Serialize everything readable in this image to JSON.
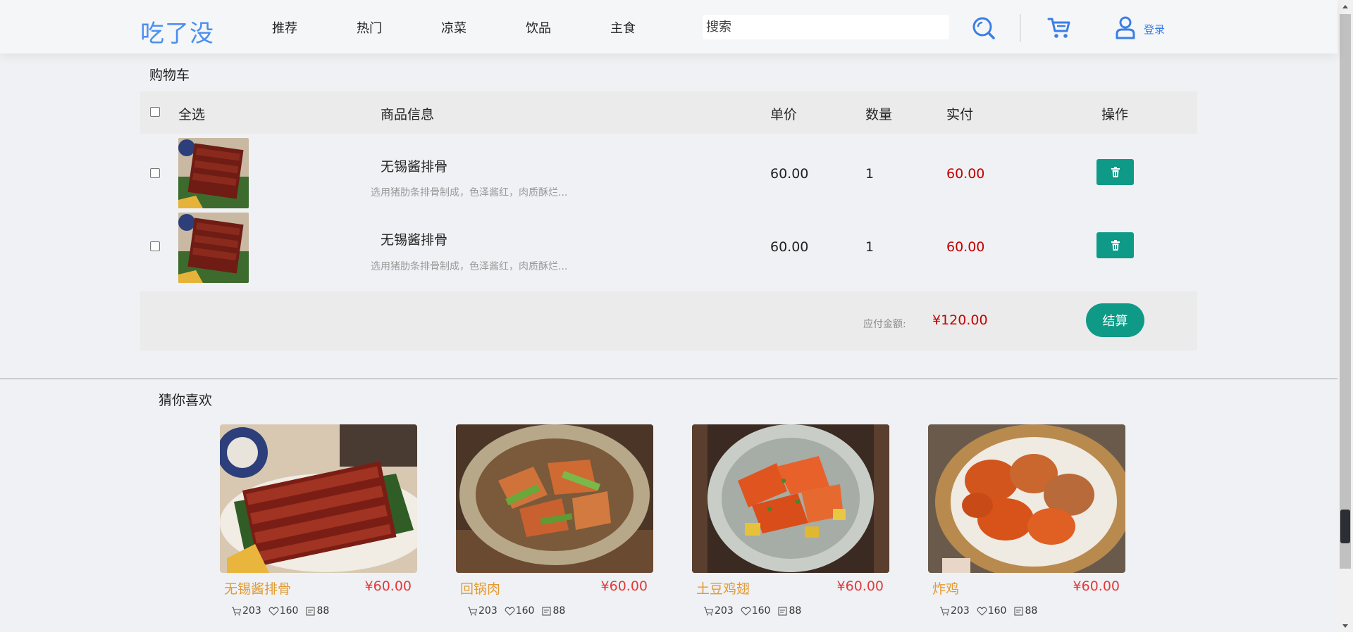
{
  "header": {
    "logo": "吃了没",
    "nav": [
      "推荐",
      "热门",
      "凉菜",
      "饮品",
      "主食"
    ],
    "search_placeholder": "搜索",
    "login_label": "登录"
  },
  "cart": {
    "title": "购物车",
    "columns": {
      "select_all": "全选",
      "product_info": "商品信息",
      "unit_price": "单价",
      "quantity": "数量",
      "paid": "实付",
      "actions": "操作"
    },
    "items": [
      {
        "name": "无锡酱排骨",
        "desc": "选用猪肋条排骨制成，色泽酱红，肉质酥烂...",
        "unit_price": "60.00",
        "quantity": "1",
        "paid": "60.00"
      },
      {
        "name": "无锡酱排骨",
        "desc": "选用猪肋条排骨制成，色泽酱红，肉质酥烂...",
        "unit_price": "60.00",
        "quantity": "1",
        "paid": "60.00"
      }
    ],
    "total_label": "应付金额:",
    "total_value": "¥120.00",
    "checkout_label": "结算"
  },
  "recommend": {
    "title": "猜你喜欢",
    "items": [
      {
        "name": "无锡酱排骨",
        "price": "¥60.00",
        "cart_count": "203",
        "like_count": "160",
        "comment_count": "88"
      },
      {
        "name": "回锅肉",
        "price": "¥60.00",
        "cart_count": "203",
        "like_count": "160",
        "comment_count": "88"
      },
      {
        "name": "土豆鸡翅",
        "price": "¥60.00",
        "cart_count": "203",
        "like_count": "160",
        "comment_count": "88"
      },
      {
        "name": "炸鸡",
        "price": "¥60.00",
        "cart_count": "203",
        "like_count": "160",
        "comment_count": "88"
      }
    ]
  },
  "colors": {
    "brand_blue": "#4a8ef1",
    "accent_teal": "#0e9a87",
    "price_red": "#c40000",
    "rec_name_orange": "#e29a32"
  }
}
